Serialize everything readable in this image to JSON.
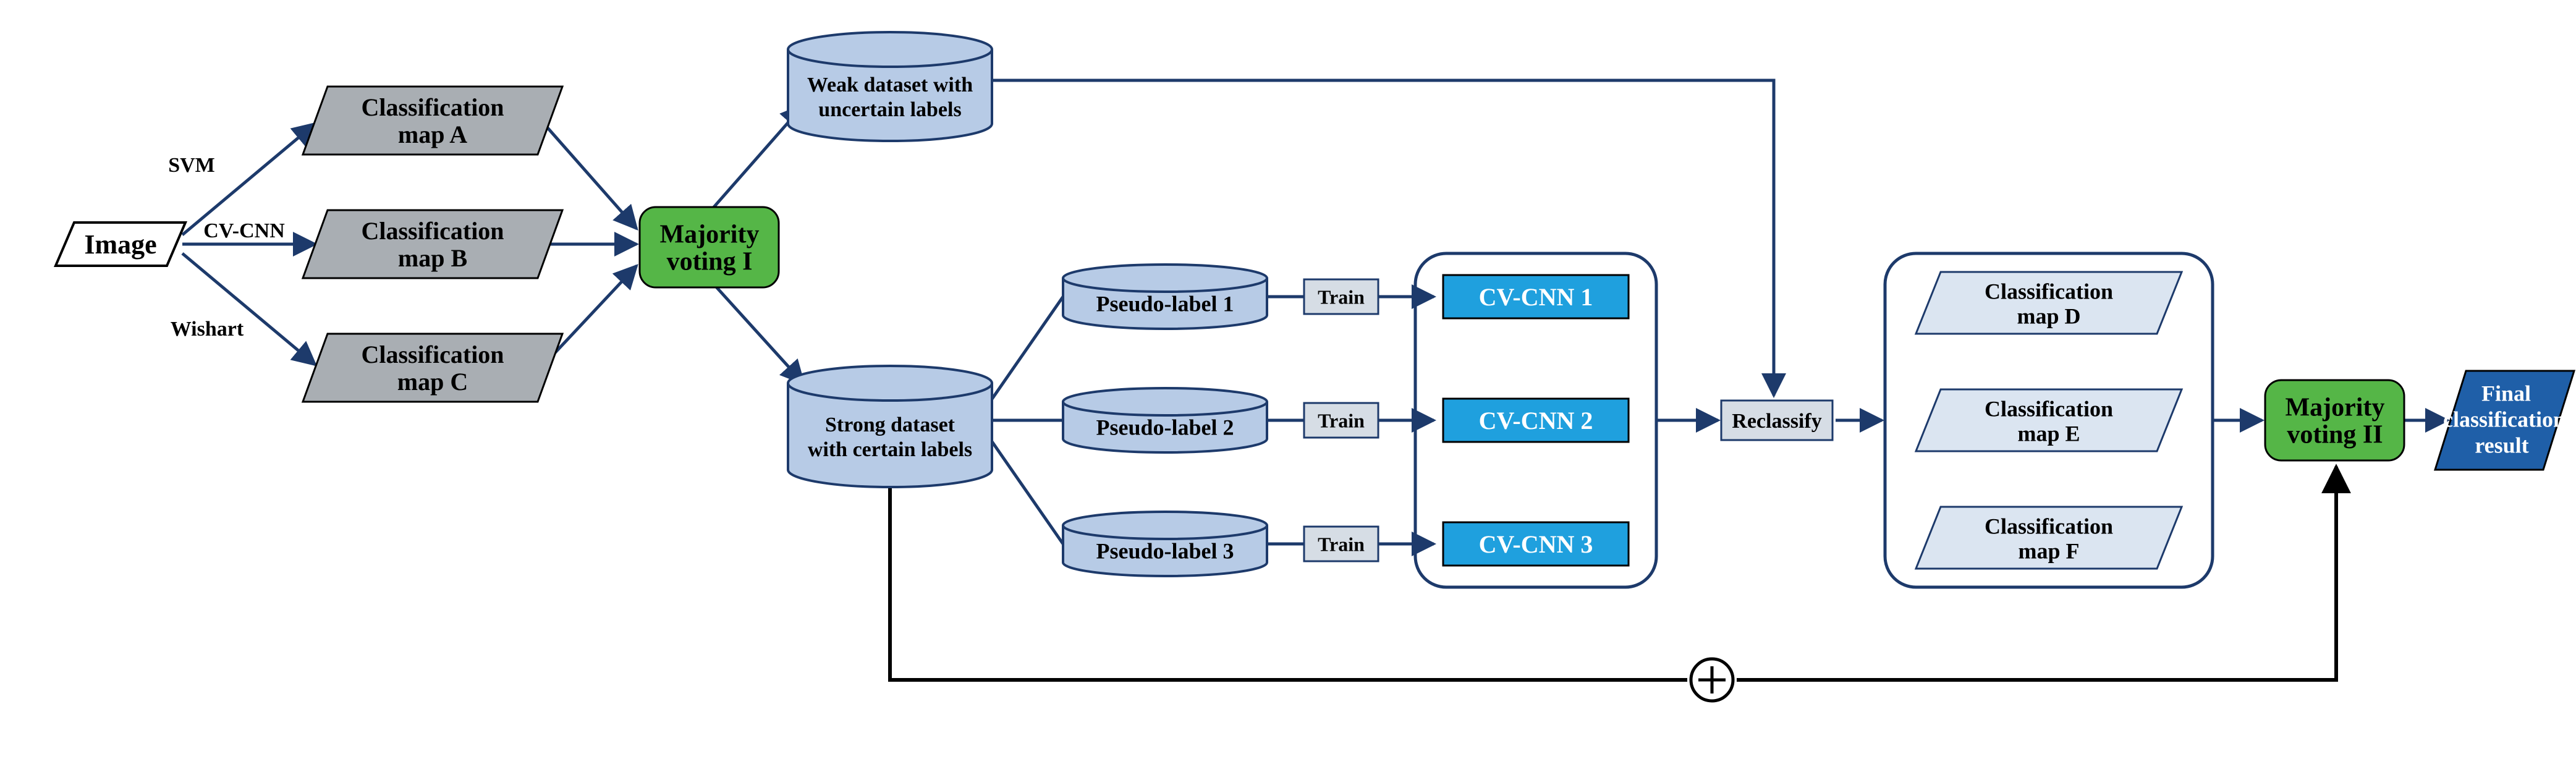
{
  "input": {
    "label": "Image"
  },
  "edges": {
    "svm": "SVM",
    "cvcnn": "CV-CNN",
    "wishart": "Wishart",
    "train1": "Train",
    "train2": "Train",
    "train3": "Train"
  },
  "maps": {
    "a1": "Classification",
    "a2": "map A",
    "b1": "Classification",
    "b2": "map B",
    "c1": "Classification",
    "c2": "map C",
    "d1": "Classification",
    "d2": "map D",
    "e1": "Classification",
    "e2": "map E",
    "f1": "Classification",
    "f2": "map F"
  },
  "voting": {
    "mv1a": "Majority",
    "mv1b": "voting I",
    "mv2a": "Majority",
    "mv2b": "voting II"
  },
  "datasets": {
    "weak1": "Weak dataset with",
    "weak2": "uncertain labels",
    "strong1": "Strong dataset",
    "strong2": "with certain labels",
    "pl1": "Pseudo-label 1",
    "pl2": "Pseudo-label 2",
    "pl3": "Pseudo-label 3"
  },
  "cvs": {
    "c1": "CV-CNN 1",
    "c2": "CV-CNN 2",
    "c3": "CV-CNN 3"
  },
  "reclassify": {
    "label": "Reclassify"
  },
  "final": {
    "l1": "Final",
    "l2": "classification",
    "l3": "result"
  }
}
